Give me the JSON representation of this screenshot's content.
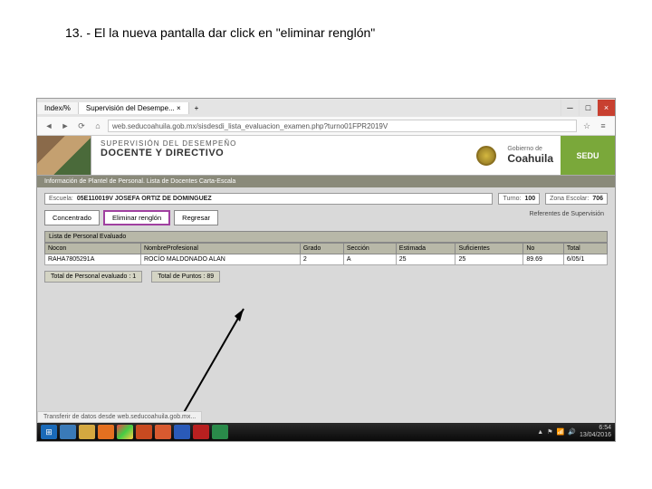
{
  "instruction": "13. - El la nueva pantalla dar click en \"eliminar renglón\"",
  "browser": {
    "tabs": [
      {
        "label": "Index/%"
      },
      {
        "label": "Supervisión del Desempe..."
      }
    ],
    "url": "web.seducoahuila.gob.mx/sisdesdi_lista_evaluacion_examen.php?turno01FPR2019V",
    "status": "Transferir de datos desde web.seducoahuila.gob.mx..."
  },
  "header": {
    "line1": "SUPERVISIÓN DEL DESEMPEÑO",
    "line2": "DOCENTE Y DIRECTIVO",
    "gov_label": "Gobierno de",
    "gov_name": "Coahuila",
    "sedu": "SEDU"
  },
  "breadcrumb": "Información de Plantel de Personal. Lista de Docentes Carta-Escala",
  "fields": {
    "escuela_label": "Escuela:",
    "escuela_value": "05E110019V JOSEFA ORTIZ DE DOMINGUEZ",
    "turno_label": "Turno:",
    "turno_value": "100",
    "zona_label": "Zona Escolar:",
    "zona_value": "706"
  },
  "actions": {
    "concentrado": "Concentrado",
    "eliminar": "Eliminar renglón",
    "regresar": "Regresar"
  },
  "sub_header": "Lista de Personal Evaluado",
  "ref_header": "Referentes de Supervisión",
  "table": {
    "headers": [
      "Nocon",
      "NombreProfesional",
      "Grado",
      "Sección",
      "Estimada",
      "Suficientes",
      "No",
      "Total"
    ],
    "row": [
      "RAHA7805291A",
      "ROCÍO MALDONADO ALAN",
      "2",
      "A",
      "25",
      "25",
      "89.69",
      "6/05/1"
    ]
  },
  "summary": {
    "personal_label": "Total de Personal evaluado :",
    "personal_value": "1",
    "puntos_label": "Total de Puntos :",
    "puntos_value": "89"
  },
  "taskbar": {
    "time": "6:54",
    "date": "13/04/2016"
  }
}
